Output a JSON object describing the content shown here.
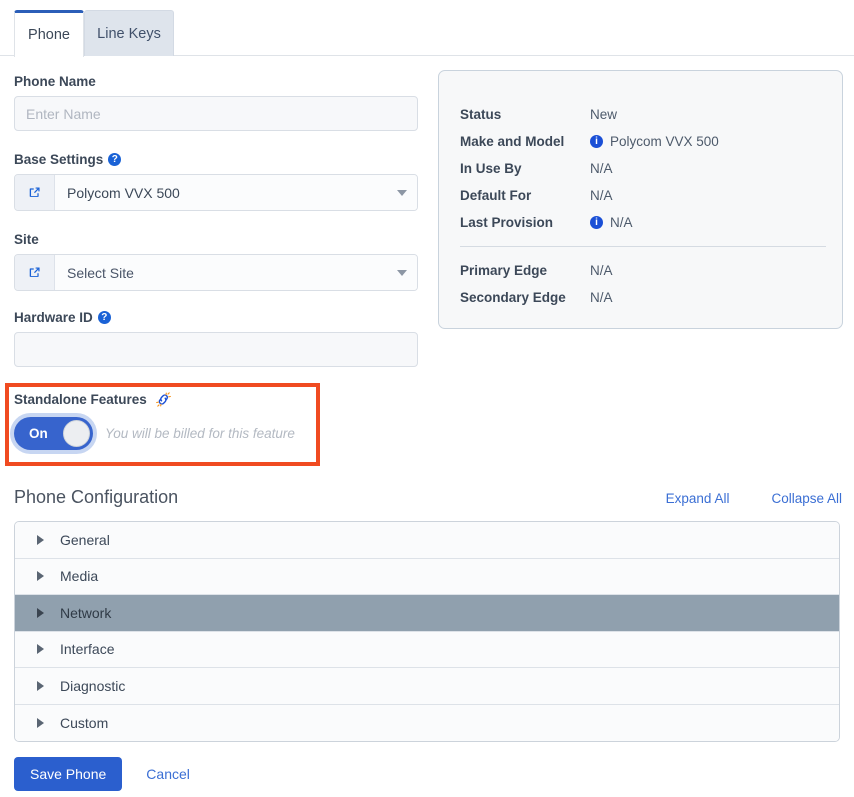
{
  "tabs": [
    {
      "label": "Phone",
      "active": true
    },
    {
      "label": "Line Keys",
      "active": false
    }
  ],
  "form": {
    "phone_name": {
      "label": "Phone Name",
      "placeholder": "Enter Name",
      "value": ""
    },
    "base_settings": {
      "label": "Base Settings",
      "help_icon": "help-circle-icon",
      "link_icon": "external-link-icon",
      "value": "Polycom VVX 500"
    },
    "site": {
      "label": "Site",
      "link_icon": "external-link-icon",
      "value": "Select Site"
    },
    "hardware_id": {
      "label": "Hardware ID",
      "help_icon": "help-circle-icon",
      "placeholder": "",
      "value": ""
    },
    "standalone_features": {
      "label": "Standalone Features",
      "icon": "broken-link-icon",
      "toggle_state": "On",
      "note": "You will be billed for this feature",
      "highlight_color": "#f04b21",
      "toggle_color": "#3764cd"
    }
  },
  "info_panel": {
    "rows": [
      {
        "key": "Status",
        "value": "New",
        "icon": null
      },
      {
        "key": "Make and Model",
        "value": "Polycom VVX 500",
        "icon": "info-circle-icon"
      },
      {
        "key": "In Use By",
        "value": "N/A",
        "icon": null
      },
      {
        "key": "Default For",
        "value": "N/A",
        "icon": null
      },
      {
        "key": "Last Provision",
        "value": "N/A",
        "icon": "info-circle-icon"
      }
    ],
    "rows_secondary": [
      {
        "key": "Primary Edge",
        "value": "N/A",
        "icon": null
      },
      {
        "key": "Secondary Edge",
        "value": "N/A",
        "icon": null
      }
    ]
  },
  "phone_configuration": {
    "title": "Phone Configuration",
    "expand_all": "Expand All",
    "collapse_all": "Collapse All",
    "sections": [
      {
        "label": "General",
        "selected": false
      },
      {
        "label": "Media",
        "selected": false
      },
      {
        "label": "Network",
        "selected": true
      },
      {
        "label": "Interface",
        "selected": false
      },
      {
        "label": "Diagnostic",
        "selected": false
      },
      {
        "label": "Custom",
        "selected": false
      }
    ],
    "selected_highlight_color": "#90a0ae"
  },
  "footer": {
    "save_label": "Save Phone",
    "cancel_label": "Cancel",
    "primary_color": "#2b5fce"
  }
}
